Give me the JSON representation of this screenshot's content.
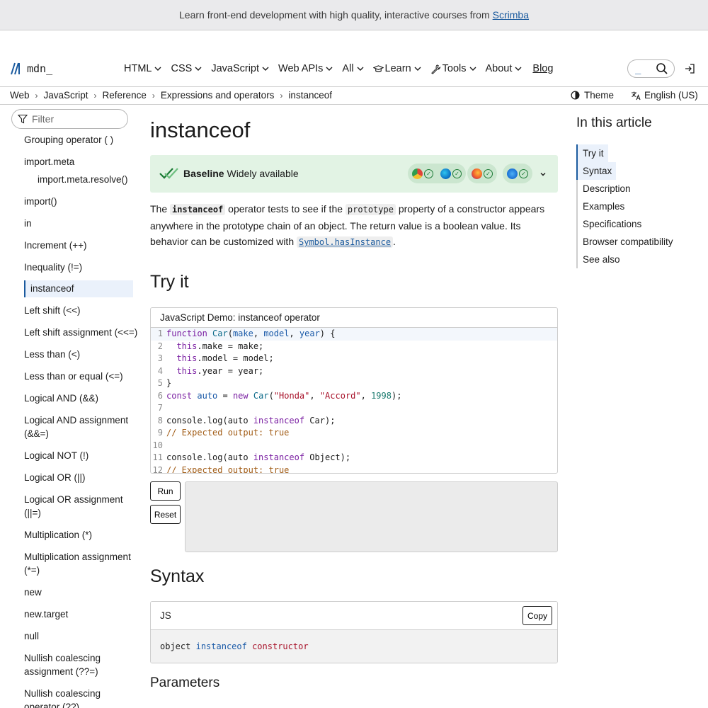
{
  "banner": {
    "text": "Learn front-end development with high quality, interactive courses from",
    "link": "Scrimba"
  },
  "header": {
    "logo_text": "mdn_",
    "nav": [
      {
        "label": "HTML",
        "icon": ""
      },
      {
        "label": "CSS",
        "icon": ""
      },
      {
        "label": "JavaScript",
        "icon": ""
      },
      {
        "label": "Web APIs",
        "icon": ""
      },
      {
        "label": "All",
        "icon": ""
      },
      {
        "label": "Learn",
        "icon": "graduation-cap-icon"
      },
      {
        "label": "Tools",
        "icon": "wrench-icon"
      },
      {
        "label": "About",
        "icon": ""
      }
    ],
    "blog": "Blog",
    "search_cursor": "_"
  },
  "breadcrumbs": [
    "Web",
    "JavaScript",
    "Reference",
    "Expressions and operators",
    "instanceof"
  ],
  "theme_label": "Theme",
  "language_label": "English (US)",
  "sidebar": {
    "filter_placeholder": "Filter",
    "items": [
      {
        "label": "Grouping operator ( )"
      },
      {
        "label": "import.meta"
      },
      {
        "label": "import.meta.resolve()",
        "sub": true
      },
      {
        "label": "import()"
      },
      {
        "label": "in"
      },
      {
        "label": "Increment (++)"
      },
      {
        "label": "Inequality (!=)"
      },
      {
        "label": "instanceof",
        "active": true
      },
      {
        "label": "Left shift (<<)"
      },
      {
        "label": "Left shift assignment (<<=)"
      },
      {
        "label": "Less than (<)"
      },
      {
        "label": "Less than or equal (<=)"
      },
      {
        "label": "Logical AND (&&)"
      },
      {
        "label": "Logical AND assignment (&&=)"
      },
      {
        "label": "Logical NOT (!)"
      },
      {
        "label": "Logical OR (||)"
      },
      {
        "label": "Logical OR assignment (||=)"
      },
      {
        "label": "Multiplication (*)"
      },
      {
        "label": "Multiplication assignment (*=)"
      },
      {
        "label": "new"
      },
      {
        "label": "new.target"
      },
      {
        "label": "null"
      },
      {
        "label": "Nullish coalescing assignment (??=)"
      },
      {
        "label": "Nullish coalescing operator (??)"
      }
    ]
  },
  "main": {
    "title": "instanceof",
    "baseline": {
      "bold": "Baseline",
      "rest": "Widely available"
    },
    "intro": {
      "p1": "The ",
      "code1": "instanceof",
      "p2": " operator tests to see if the ",
      "code2": "prototype",
      "p3": " property of a constructor appears anywhere in the prototype chain of an object. The return value is a boolean value. Its behavior can be customized with ",
      "code3": "Symbol.hasInstance",
      "p4": "."
    },
    "try_it": "Try it",
    "demo_title": "JavaScript Demo: instanceof operator",
    "run": "Run",
    "reset": "Reset",
    "syntax": "Syntax",
    "syntax_lang": "JS",
    "copy": "Copy",
    "syntax_code": {
      "a": "object",
      "b": "instanceof",
      "c": "constructor"
    },
    "parameters": "Parameters"
  },
  "toc": {
    "title": "In this article",
    "items": [
      "Try it",
      "Syntax",
      "Description",
      "Examples",
      "Specifications",
      "Browser compatibility",
      "See also"
    ]
  },
  "colors": {
    "accent": "#1a5a9e",
    "baseline_bg": "#e2f3e4"
  }
}
